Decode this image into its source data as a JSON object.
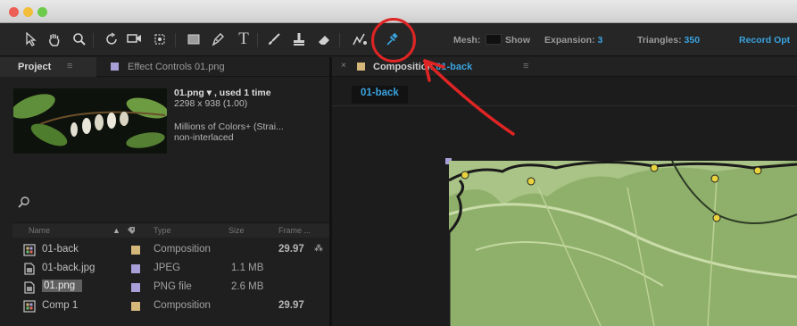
{
  "toolbar": {
    "tools": [
      "selection-tool",
      "hand-tool",
      "zoom-tool",
      "rotate-tool",
      "camera-tool",
      "pan-behind-tool",
      "rectangle-tool",
      "pen-tool",
      "type-tool",
      "brush-tool",
      "clone-stamp-tool",
      "eraser-tool",
      "roto-brush-tool",
      "puppet-pin-tool"
    ],
    "mesh_label": "Mesh:",
    "show_label": "Show",
    "expansion_label": "Expansion:",
    "expansion_value": "3",
    "triangles_label": "Triangles:",
    "triangles_value": "350",
    "record_label": "Record Opt"
  },
  "project_panel": {
    "tab_label": "Project",
    "effects_tab_label": "Effect Controls 01.png",
    "selected_asset": {
      "name_line": "01.png ▾ , used 1 time",
      "dimensions": "2298 x 938 (1.00)",
      "colors": "Millions of Colors+ (Strai...",
      "interlace": "non-interlaced"
    },
    "columns": [
      "Name",
      "Type",
      "Size",
      "Frame ..."
    ],
    "rows": [
      {
        "name": "01-back",
        "type": "Composition",
        "size": "",
        "frame": "29.97",
        "icon": "composition-icon",
        "label_color": "#d5b77a"
      },
      {
        "name": "01-back.jpg",
        "type": "JPEG",
        "size": "1.1 MB",
        "frame": "",
        "icon": "file-icon",
        "label_color": "#a89ed8"
      },
      {
        "name": "01.png",
        "type": "PNG file",
        "size": "2.6 MB",
        "frame": "",
        "icon": "file-icon",
        "label_color": "#a89ed8",
        "selected": true
      },
      {
        "name": "Comp 1",
        "type": "Composition",
        "size": "",
        "frame": "29.97",
        "icon": "composition-icon",
        "label_color": "#d5b77a"
      }
    ]
  },
  "composition_panel": {
    "close": "×",
    "title_prefix": "Composition",
    "comp_name": "01-back",
    "sub_tab": "01-back"
  },
  "colors": {
    "accent_blue": "#3aa3e0",
    "annotation_red": "#e02424"
  }
}
